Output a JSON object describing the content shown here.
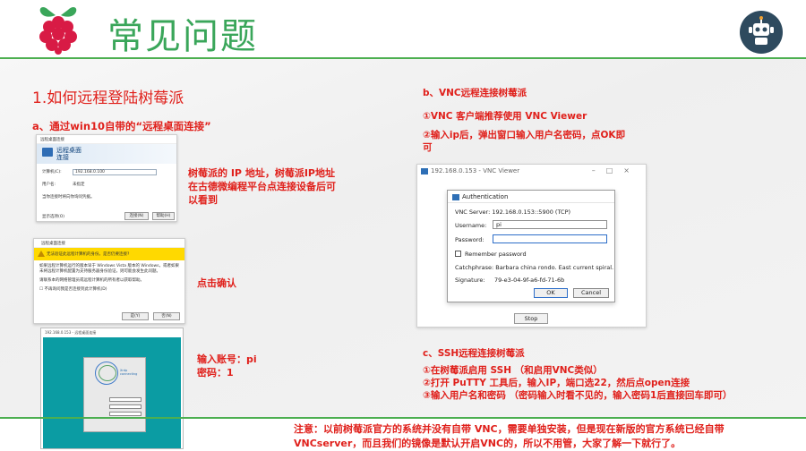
{
  "header": {
    "title": "常见问题"
  },
  "left": {
    "section_title": "1.如何远程登陆树莓派",
    "sub_a": "a、通过win10自带的“远程桌面连接”",
    "note_ip": "树莓派的 IP 地址，树莓派IP地址在古德微编程平台点连接设备后可以看到",
    "note_ok": "点击确认",
    "note_account_1": "输入账号：pi",
    "note_account_2": "密码：1"
  },
  "rdc_window": {
    "title": "远程桌面连接",
    "hero_line1": "远程桌面",
    "hero_line2": "连接",
    "computer_label": "计算机(C):",
    "computer_value": "192.168.0.100",
    "user_label": "用户名:",
    "user_value": "未指定",
    "hint": "当你连接时将向你询问凭据。",
    "options": "显示选项(O)",
    "connect_btn": "连接(N)",
    "help_btn": "帮助(H)"
  },
  "warn_window": {
    "title": "远程桌面连接",
    "band_text": "无法验证此远程计算机的身份。是否仍要连接?",
    "body_1": "如果远程计算机运行的版本早于 Windows Vista 版本的 Windows，或者如果未将远程计算机配置为支持服务器身份验证，则可能会发生此问题。",
    "body_2": "请联系本的网络管理员或远程计算机的所有者以获取帮助。",
    "checkbox": "不再询问我是否连接到此计算机(D)",
    "yes_btn": "是(Y)",
    "no_btn": "否(N)"
  },
  "login_window": {
    "title": "192.168.0.153 - 远程桌面连接",
    "brand": "Xrdp connecting"
  },
  "right": {
    "sub_b": "b、VNC远程连接树莓派",
    "b1": "①VNC 客户端推荐使用 VNC Viewer",
    "b2": "②输入ip后，弹出窗口输入用户名密码，点OK即可",
    "sub_c": "c、SSH远程连接树莓派",
    "c1": "①在树莓派启用 SSH （和启用VNC类似）",
    "c2": "②打开 PuTTY 工具后，输入IP，端口选22，然后点open连接",
    "c3": "③输入用户名和密码 （密码输入时看不见的，输入密码1后直接回车即可）"
  },
  "vnc": {
    "window_title": "192.168.0.153 - VNC Viewer",
    "auth_title": "Authentication",
    "server_line": "VNC Server:  192.168.0.153::5900 (TCP)",
    "username_label": "Username:",
    "username_value": "pi",
    "password_label": "Password:",
    "remember": "Remember password",
    "catchphrase": "Catchphrase: Barbara china rondo. East current spiral.",
    "signature_label": "Signature:",
    "signature_value": "79-e3-04-9f-a6-fd-71-6b",
    "ok_btn": "OK",
    "cancel_btn": "Cancel",
    "stop_btn": "Stop"
  },
  "footer": {
    "note": "注意：以前树莓派官方的系统并没有自带 VNC，需要单独安装，但是现在新版的官方系统已经自带 VNCserver，而且我们的镜像是默认开启VNC的，所以不用管，大家了解一下就行了。"
  },
  "colors": {
    "title_green": "#3aa65a",
    "rule_green": "#4caf50",
    "accent_red": "#e0201b"
  }
}
